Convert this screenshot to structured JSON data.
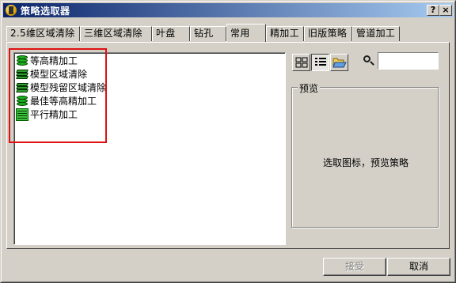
{
  "window": {
    "title": "策略选取器",
    "help_label": "?",
    "close_label": "×"
  },
  "tabs": [
    {
      "label": "2.5维区域清除"
    },
    {
      "label": "三维区域清除"
    },
    {
      "label": "叶盘"
    },
    {
      "label": "钻孔"
    },
    {
      "label": "常用",
      "active": true
    },
    {
      "label": "精加工"
    },
    {
      "label": "旧版策略"
    },
    {
      "label": "管道加工"
    }
  ],
  "strategies": [
    {
      "label": "等高精加工",
      "icon": "stacked-discs-icon"
    },
    {
      "label": "模型区域清除",
      "icon": "stacked-blocks-icon"
    },
    {
      "label": "模型残留区域清除",
      "icon": "stacked-blocks-icon"
    },
    {
      "label": "最佳等高精加工",
      "icon": "stacked-discs-icon"
    },
    {
      "label": "平行精加工",
      "icon": "parallel-lines-icon"
    }
  ],
  "view_buttons": [
    {
      "icon": "large-icons-view-icon"
    },
    {
      "icon": "list-view-icon",
      "pressed": true
    },
    {
      "icon": "open-folder-icon"
    }
  ],
  "search": {
    "value": "",
    "placeholder": ""
  },
  "preview": {
    "legend": "预览",
    "text": "选取图标，预览策略"
  },
  "buttons": {
    "accept_label": "接受",
    "cancel_label": "取消"
  },
  "colors": {
    "highlight": "#e01010",
    "titlebar_start": "#0a246a",
    "titlebar_end": "#a6caf0",
    "icon_green": "#20b020"
  }
}
